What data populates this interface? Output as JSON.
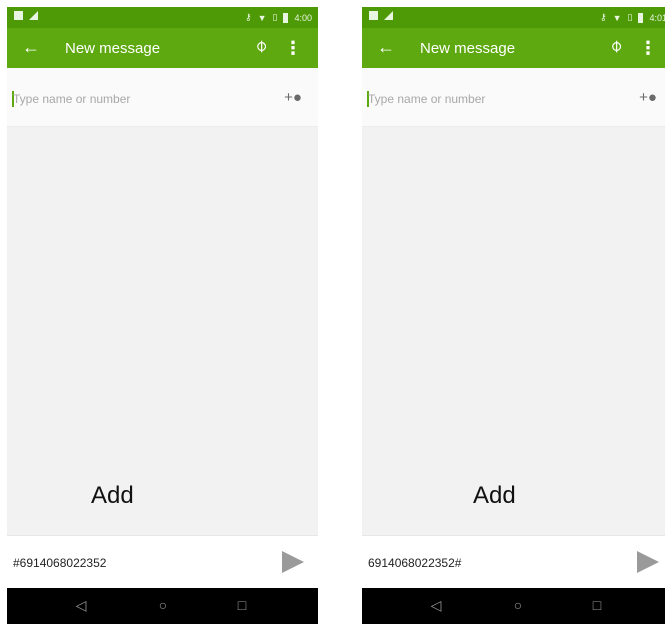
{
  "phones": [
    {
      "status_time": "4:00",
      "title": "New message",
      "recipient_placeholder": "Type name or number",
      "overlay_text": "Add",
      "message_text": "#6914068022352"
    },
    {
      "status_time": "4:01",
      "title": "New message",
      "recipient_placeholder": "Type name or number",
      "overlay_text": "Add",
      "message_text": "6914068022352#"
    }
  ],
  "icons": {
    "back": "arrow-left",
    "attach": "paperclip",
    "more": "vertical-dots",
    "add_contact": "add-person",
    "send": "send-triangle",
    "nav_back": "triangle-left",
    "nav_home": "circle",
    "nav_recent": "square"
  },
  "colors": {
    "status_bar": "#4e9a06",
    "toolbar": "#5da90f",
    "accent_cursor": "#5da90f",
    "send_icon": "#9a9a9a",
    "nav_bar": "#000000"
  }
}
